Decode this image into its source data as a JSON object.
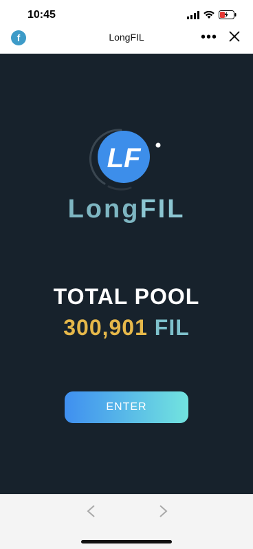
{
  "status_bar": {
    "time": "10:45",
    "icons": [
      "signal-icon",
      "wifi-icon",
      "battery-charging-icon"
    ]
  },
  "nav": {
    "title": "LongFIL",
    "more_icon": "more-icon",
    "close_icon": "close-icon",
    "app_icon": "filecoin-icon",
    "app_icon_glyph": "f"
  },
  "app": {
    "logo_icon": "longfil-logo-icon",
    "brand_part1": "Long",
    "brand_part2": "FIL",
    "total_pool_label": "TOTAL POOL",
    "total_pool_amount": "300,901",
    "total_pool_unit": "FIL",
    "enter_label": "ENTER"
  },
  "colors": {
    "background": "#17222c",
    "brand": "#7eb6c2",
    "amount": "#e6b84a",
    "unit": "#7ec1cc",
    "button_start": "#3f8ff0",
    "button_end": "#72e4df"
  },
  "bottom_nav": {
    "back_icon": "chevron-left-icon",
    "forward_icon": "chevron-right-icon"
  }
}
